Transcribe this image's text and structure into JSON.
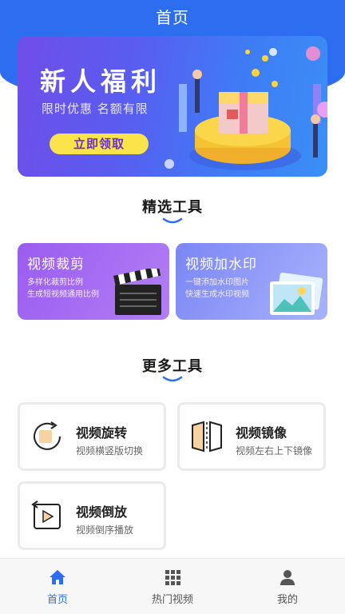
{
  "header": {
    "title": "首页"
  },
  "banner": {
    "title": "新人福利",
    "subtitle": "限时优惠  名额有限",
    "button_label": "立即领取"
  },
  "featured": {
    "title": "精选工具",
    "cards": [
      {
        "title": "视频裁剪",
        "desc_line1": "多样化裁剪比例",
        "desc_line2": "生成短视频通用比例"
      },
      {
        "title": "视频加水印",
        "desc_line1": "一键添加水印图片",
        "desc_line2": "快速生成水印视频"
      }
    ]
  },
  "more": {
    "title": "更多工具",
    "tools": [
      {
        "name": "视频旋转",
        "desc": "视频横竖版切换",
        "icon": "rotate-icon"
      },
      {
        "name": "视频镜像",
        "desc": "视频左右上下镜像",
        "icon": "mirror-icon"
      },
      {
        "name": "视频倒放",
        "desc": "视频倒序播放",
        "icon": "reverse-play-icon"
      }
    ]
  },
  "nav": {
    "items": [
      {
        "label": "首页",
        "icon": "home-icon",
        "active": true
      },
      {
        "label": "热门视频",
        "icon": "grid-icon",
        "active": false
      },
      {
        "label": "我的",
        "icon": "user-icon",
        "active": false
      }
    ]
  },
  "colors": {
    "primary": "#2d6df0",
    "accent_yellow": "#fbe34a"
  }
}
